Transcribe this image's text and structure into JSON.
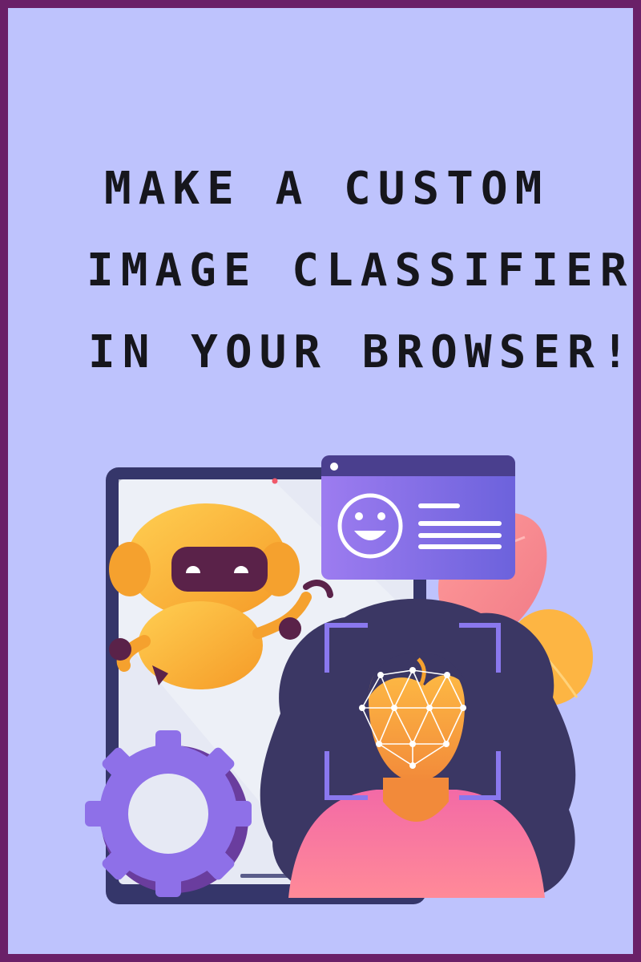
{
  "headline": {
    "line1": "MAKE A CUSTOM",
    "line2": "IMAGE CLASSIFIER",
    "line3": "IN YOUR BROWSER!"
  },
  "colors": {
    "background": "#bec3fd",
    "border": "#6a2068",
    "text": "#16161c",
    "robot": "#f9b43a",
    "window": "#8a78ee",
    "hair": "#3b3764",
    "shirt": "#f6779e",
    "gear": "#8e70e8"
  },
  "icons": [
    "robot-icon",
    "tablet-icon",
    "smiley-window-icon",
    "gear-icon",
    "face-scan-icon",
    "leaf-icon"
  ]
}
